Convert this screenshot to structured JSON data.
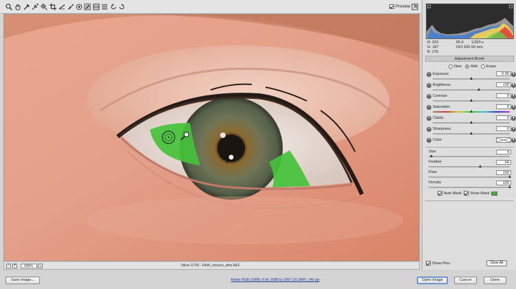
{
  "toolbar": {
    "tools": [
      "zoom-icon",
      "hand-icon",
      "white-balance-icon",
      "color-sampler-icon",
      "targeted-adjustment-icon",
      "crop-icon",
      "straighten-icon",
      "spot-removal-icon",
      "red-eye-icon",
      "adjustment-brush-icon",
      "graduated-filter-icon",
      "preferences-icon",
      "rotate-left-icon",
      "rotate-right-icon"
    ],
    "active_tool": "adjustment-brush-icon",
    "preview_label": "Preview",
    "preview_checked": true
  },
  "histogram": {
    "readout": {
      "r": "R:  203",
      "g": "G:  187",
      "b": "B:  176"
    },
    "exif": {
      "aperture": "f/5.6",
      "shutter": "1/320 s",
      "iso": "ISO 200",
      "focal": "60 mm"
    }
  },
  "adjustment_brush": {
    "title": "Adjustment Brush",
    "modes": [
      {
        "label": "New",
        "selected": false
      },
      {
        "label": "Add",
        "selected": true
      },
      {
        "label": "Erase",
        "selected": false
      }
    ],
    "sliders": [
      {
        "label": "Exposure",
        "value": "0.00",
        "pos": 0.5
      },
      {
        "label": "Brightness",
        "value": "+20",
        "pos": 0.6
      },
      {
        "label": "Contrast",
        "value": "0",
        "pos": 0.5
      },
      {
        "label": "Saturation",
        "value": "0",
        "pos": 0.5
      },
      {
        "label": "Clarity",
        "value": "0",
        "pos": 0.5
      },
      {
        "label": "Sharpness",
        "value": "0",
        "pos": 0.5
      }
    ],
    "color_label": "Color",
    "brush": [
      {
        "label": "Size",
        "value": "4",
        "pos": 0.04
      },
      {
        "label": "Feather",
        "value": "64",
        "pos": 0.64
      },
      {
        "label": "Flow",
        "value": "100",
        "pos": 1.0
      },
      {
        "label": "Density",
        "value": "100",
        "pos": 1.0
      }
    ],
    "auto_mask_label": "Auto Mask",
    "auto_mask_checked": true,
    "show_mask_label": "Show Mask",
    "show_mask_checked": true,
    "mask_color": "#40b82e",
    "show_pins_label": "Show Pins",
    "show_pins_checked": true,
    "clear_all_label": "Clear All"
  },
  "statusbar": {
    "zoom": "300%",
    "filename": "Nikon D700  -  RAW_retouch_after.NEF"
  },
  "bottom": {
    "save_label": "Save Image...",
    "workflow_link": "Adobe RGB (1998); 8 bit; 2588 by 3997 (10.3MP); 240 ppi",
    "open_label": "Open Image",
    "cancel_label": "Cancel",
    "done_label": "Done"
  }
}
